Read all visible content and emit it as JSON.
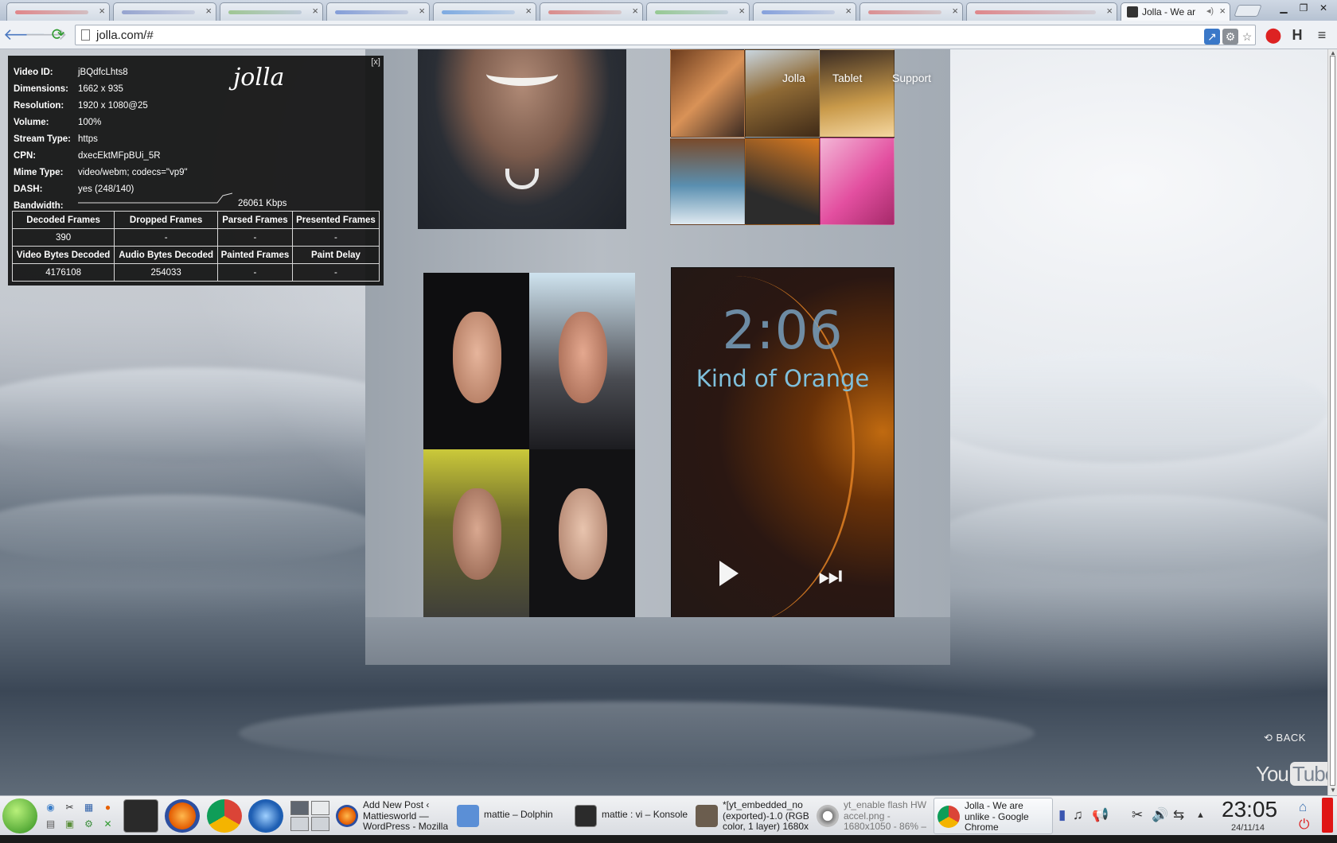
{
  "browser": {
    "active_tab_title": "Jolla - We ar",
    "url": "jolla.com/#",
    "blurred_tab_count": 10
  },
  "site_nav": [
    "Jolla",
    "Tablet",
    "Support"
  ],
  "video": {
    "phone_time": "2:06",
    "phone_song": "Kind of Orange",
    "back_label": "BACK",
    "youtube_you": "You",
    "youtube_tube": "Tube"
  },
  "stats": {
    "logo": "jolla",
    "close_label": "[x]",
    "rows": [
      {
        "key": "Video ID:",
        "value": "jBQdfcLhts8"
      },
      {
        "key": "Dimensions:",
        "value": "1662 x 935"
      },
      {
        "key": "Resolution:",
        "value": "1920 x 1080@25"
      },
      {
        "key": "Volume:",
        "value": "100%"
      },
      {
        "key": "Stream Type:",
        "value": "https"
      },
      {
        "key": "CPN:",
        "value": "dxecEktMFpBUi_5R"
      },
      {
        "key": "Mime Type:",
        "value": "video/webm; codecs=\"vp9\""
      },
      {
        "key": "DASH:",
        "value": "yes (248/140)"
      },
      {
        "key": "Bandwidth:",
        "value": ""
      }
    ],
    "bandwidth_value": "26061 Kbps",
    "table": {
      "header1": [
        "Decoded Frames",
        "Dropped Frames",
        "Parsed Frames",
        "Presented Frames"
      ],
      "values1": [
        "390",
        "-",
        "-",
        "-"
      ],
      "header2": [
        "Video Bytes Decoded",
        "Audio Bytes Decoded",
        "Painted Frames",
        "Paint Delay"
      ],
      "values2": [
        "4176108",
        "254033",
        "-",
        "-"
      ]
    }
  },
  "taskbar": {
    "tasks": [
      {
        "label": "Add New Post ‹\nMattiesworld —\nWordPress - Mozilla",
        "icon_color": "#e66000",
        "icon": "firefox-icon"
      },
      {
        "label": "mattie – Dolphin",
        "icon_color": "#5b8fd6",
        "icon": "folder-icon"
      },
      {
        "label": "mattie : vi – Konsole",
        "icon_color": "#2b2b2b",
        "icon": "terminal-icon"
      },
      {
        "label": "*[yt_embedded_no\n(exported)-1.0 (RGB\ncolor, 1 layer) 1680x",
        "icon_color": "#6b5d4e",
        "icon": "gimp-icon"
      },
      {
        "label": "yt_enable flash HW\naccel.png -\n1680x1050 - 86% –",
        "icon_color": "#7a7a7a",
        "icon": "eye-icon"
      },
      {
        "label": "Jolla - We are\nunlike - Google\nChrome",
        "icon_color": "#3c8a3a",
        "icon": "chrome-icon"
      }
    ],
    "clock": "23:05",
    "date": "24/11/14"
  }
}
